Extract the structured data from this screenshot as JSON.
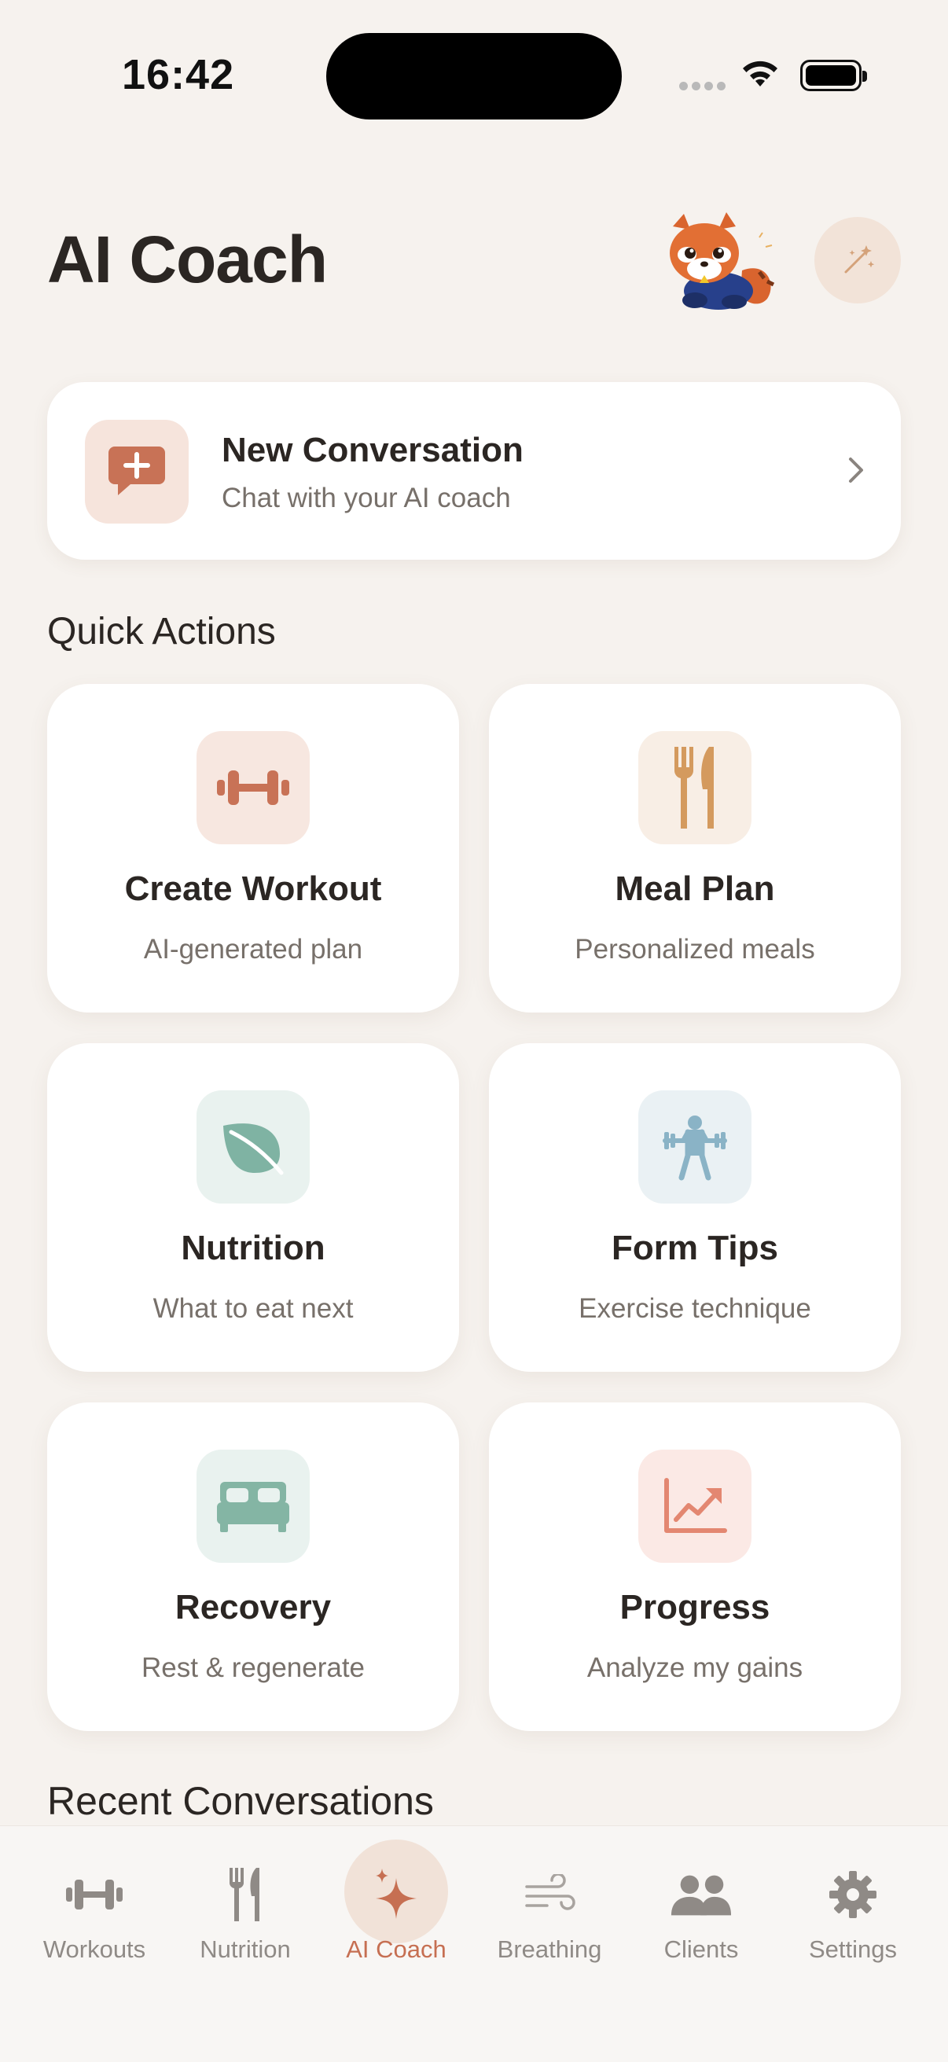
{
  "status_bar": {
    "time": "16:42"
  },
  "header": {
    "title": "AI Coach"
  },
  "new_conversation": {
    "title": "New Conversation",
    "subtitle": "Chat with your AI coach"
  },
  "quick_actions": {
    "title": "Quick Actions",
    "items": [
      {
        "title": "Create Workout",
        "subtitle": "AI-generated plan",
        "icon": "dumbbell-icon",
        "color": "#c87256"
      },
      {
        "title": "Meal Plan",
        "subtitle": "Personalized meals",
        "icon": "fork-knife-icon",
        "color": "#d49a5e"
      },
      {
        "title": "Nutrition",
        "subtitle": "What to eat next",
        "icon": "leaf-icon",
        "color": "#7fb3a3"
      },
      {
        "title": "Form Tips",
        "subtitle": "Exercise technique",
        "icon": "weightlifter-icon",
        "color": "#8ab3c6"
      },
      {
        "title": "Recovery",
        "subtitle": "Rest & regenerate",
        "icon": "bed-icon",
        "color": "#84b5a4"
      },
      {
        "title": "Progress",
        "subtitle": "Analyze my gains",
        "icon": "chart-up-icon",
        "color": "#e38771"
      }
    ]
  },
  "recent": {
    "title": "Recent Conversations"
  },
  "tabs": [
    {
      "label": "Workouts",
      "icon": "dumbbell-icon"
    },
    {
      "label": "Nutrition",
      "icon": "fork-knife-icon"
    },
    {
      "label": "AI Coach",
      "icon": "sparkle-icon",
      "active": true
    },
    {
      "label": "Breathing",
      "icon": "wind-icon"
    },
    {
      "label": "Clients",
      "icon": "people-icon"
    },
    {
      "label": "Settings",
      "icon": "gear-icon"
    }
  ],
  "colors": {
    "accent": "#c66f52",
    "background": "#f6f2ee",
    "card": "#ffffff"
  }
}
